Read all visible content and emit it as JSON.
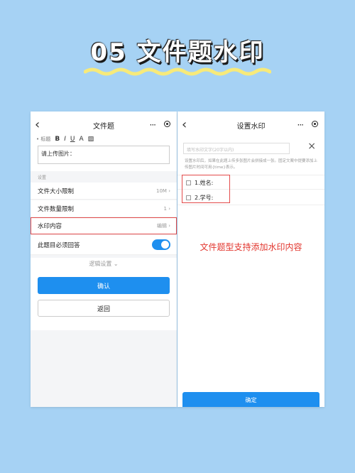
{
  "headline": "05 文件题水印",
  "colors": {
    "background": "#a6d2f4",
    "accent": "#1e8fef",
    "highlight": "#e34b4b",
    "caption": "#e2362e",
    "wave": "#f7ea7a"
  },
  "left": {
    "nav_title": "文件题",
    "more_icon": "···",
    "toolbar": {
      "label": "标题",
      "bold": "B",
      "italic": "I",
      "underline": "U",
      "color": "A"
    },
    "textarea_value": "请上传图片：",
    "section_label": "设置",
    "rows": [
      {
        "label": "文件大小限制",
        "value": "10M"
      },
      {
        "label": "文件数量限制",
        "value": "1"
      },
      {
        "label": "水印内容",
        "value": "编辑"
      }
    ],
    "required_label": "此题目必须回答",
    "required_on": true,
    "logic_label": "逻辑设置",
    "confirm": "确认",
    "back": "返回"
  },
  "right": {
    "nav_title": "设置水印",
    "more_icon": "···",
    "search_placeholder": "填写水印文字(20字以内)",
    "description": "设置水印后，如果在此题上传多张图片会拼接成一张。固定文案中提要添加上传图片时间可用{time}表示。",
    "options": [
      "1.姓名:",
      "2.学号:"
    ],
    "caption": "文件题型支持添加水印内容",
    "confirm": "确定"
  }
}
